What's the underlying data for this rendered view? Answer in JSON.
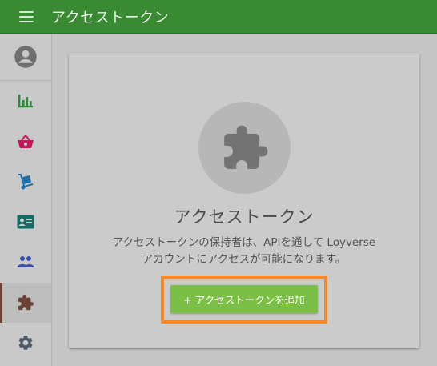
{
  "header": {
    "title": "アクセストークン",
    "menu_icon": "hamburger-menu-icon",
    "background": "#3a8a34"
  },
  "sidebar": {
    "items": [
      {
        "icon": "account-circle-icon",
        "active": false
      },
      {
        "icon": "bar-chart-icon",
        "color": "#2f8a3b",
        "active": false
      },
      {
        "icon": "shopping-basket-icon",
        "color": "#c2185b",
        "active": false
      },
      {
        "icon": "hand-truck-icon",
        "color": "#1e6fa8",
        "active": false
      },
      {
        "icon": "contact-card-icon",
        "color": "#146b64",
        "active": false
      },
      {
        "icon": "people-icon",
        "color": "#3e4fa5",
        "active": false
      },
      {
        "icon": "puzzle-piece-icon",
        "color": "#6b4337",
        "active": true
      },
      {
        "icon": "gear-icon",
        "color": "#4f5b66",
        "active": false
      }
    ]
  },
  "empty_state": {
    "icon": "puzzle-piece-icon",
    "title": "アクセストークン",
    "description_line1": "アクセストークンの保持者は、APIを通して Loyverse",
    "description_line2": "アカウントにアクセスが可能になります。",
    "add_button_label": "+ アクセストークンを追加",
    "button_color": "#7cbf46",
    "highlight_color": "#ef8a2e"
  }
}
